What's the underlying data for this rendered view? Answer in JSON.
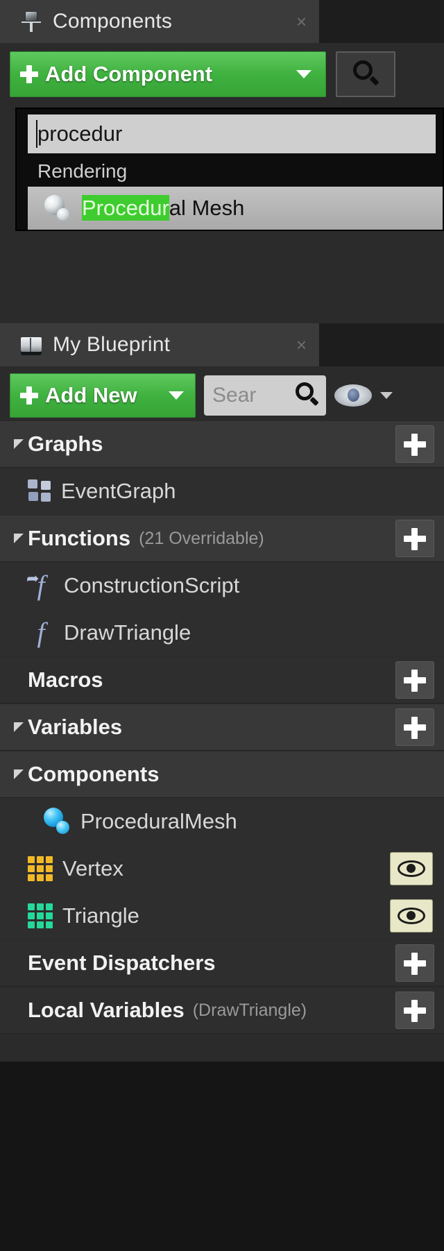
{
  "components_panel": {
    "tab_label": "Components",
    "tab_icon": "gizmo-icon",
    "close_label": "×",
    "add_component_label": "Add Component",
    "search_icon": "magnifier-icon",
    "dropdown": {
      "search_value": "procedur",
      "search_placeholder": "",
      "category": "Rendering",
      "results": [
        {
          "name_prefix": "Procedur",
          "name_suffix": "al Mesh",
          "icon": "mesh-sphere-icon"
        }
      ]
    }
  },
  "myblueprint_panel": {
    "tab_label": "My Blueprint",
    "tab_icon": "book-icon",
    "close_label": "×",
    "add_new_label": "Add New",
    "search_placeholder": "Sear",
    "search_value": "",
    "visibility_icon": "eye-icon",
    "tree": [
      {
        "kind": "section",
        "label": "Graphs",
        "sub": "",
        "expanded": true,
        "add": true
      },
      {
        "kind": "item",
        "label": "EventGraph",
        "icon": "event-graph-icon",
        "indent": 1
      },
      {
        "kind": "section",
        "label": "Functions",
        "sub": "(21 Overridable)",
        "expanded": true,
        "add": true
      },
      {
        "kind": "item",
        "label": "ConstructionScript",
        "icon": "construction-script-icon",
        "indent": 1
      },
      {
        "kind": "item",
        "label": "DrawTriangle",
        "icon": "function-icon",
        "indent": 1
      },
      {
        "kind": "section",
        "label": "Macros",
        "sub": "",
        "expanded": false,
        "add": true
      },
      {
        "kind": "section",
        "label": "Variables",
        "sub": "",
        "expanded": true,
        "add": true
      },
      {
        "kind": "section",
        "label": "Components",
        "sub": "",
        "expanded": true,
        "add": false
      },
      {
        "kind": "item",
        "label": "ProceduralMesh",
        "icon": "blue-sphere-icon",
        "indent": 2
      },
      {
        "kind": "item",
        "label": "Vertex",
        "icon": "array-grid-icon",
        "indent": 1,
        "color": "#f2b927",
        "eye": true
      },
      {
        "kind": "item",
        "label": "Triangle",
        "icon": "array-grid-icon",
        "indent": 1,
        "color": "#24d99a",
        "eye": true
      },
      {
        "kind": "section",
        "label": "Event Dispatchers",
        "sub": "",
        "expanded": false,
        "add": true
      },
      {
        "kind": "section",
        "label": "Local Variables",
        "sub": "(DrawTriangle)",
        "expanded": false,
        "add": true
      }
    ]
  },
  "colors": {
    "accent_green": "#3fb13f",
    "highlight_green": "#3fcc2f",
    "panel_bg": "#2b2b2b",
    "section_bg": "#383838",
    "vertex_yellow": "#f2b927",
    "triangle_teal": "#24d99a"
  }
}
